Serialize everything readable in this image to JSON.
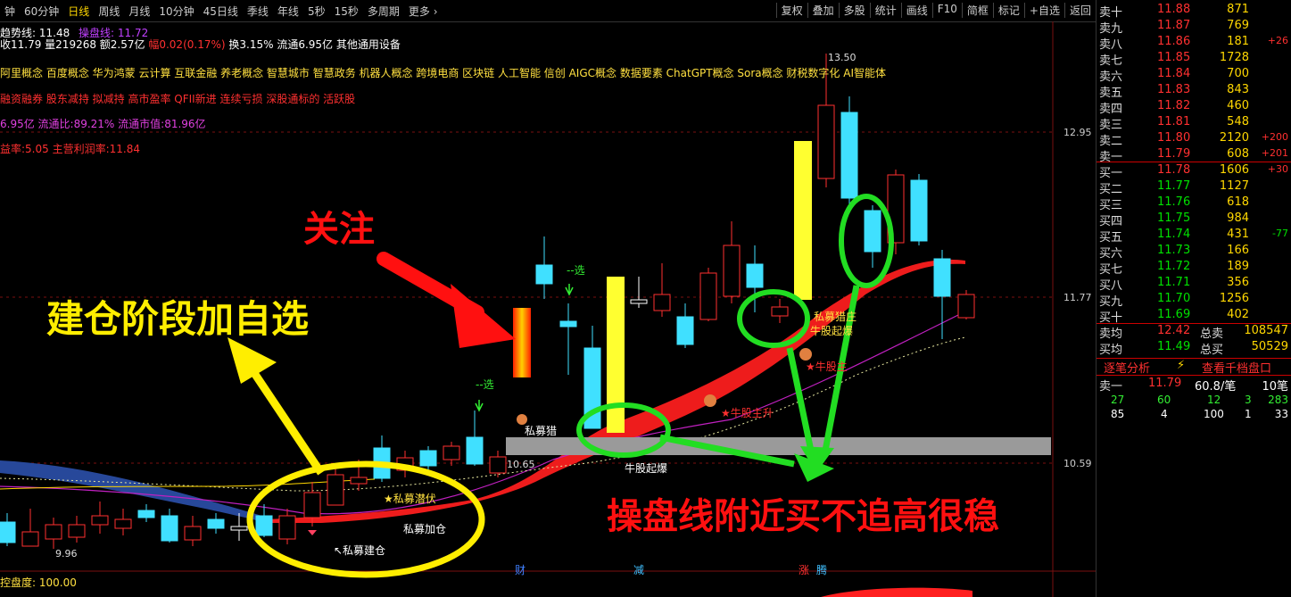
{
  "toolbar": {
    "periods": [
      "钟",
      "60分钟",
      "日线",
      "周线",
      "月线",
      "10分钟",
      "45日线",
      "季线",
      "年线",
      "5秒",
      "15秒",
      "多周期",
      "更多 ›"
    ],
    "tools": [
      "复权",
      "叠加",
      "多股",
      "统计",
      "画线",
      "F10",
      "简框",
      "标记",
      "+自选",
      "返回"
    ]
  },
  "chart_info": {
    "line1_a": "趋势线: 11.48",
    "line1_b": "操盘线: 11.72",
    "line2_a": "收11.79 量219268 额2.57亿",
    "line2_b": "幅0.02(0.17%)",
    "line2_c": "换3.15% 流通6.95亿 其他通用设备",
    "concepts": "阿里概念 百度概念 华为鸿蒙 云计算 互联金融 养老概念 智慧城市 智慧政务 机器人概念 跨境电商 区块链 人工智能 信创 AIGC概念 数据要素 ChatGPT概念 Sora概念 财税数字化 AI智能体",
    "tags": "融资融券 股东减持 拟减持 高市盈率 QFII新进 连续亏损 深股通标的 活跃股",
    "float": "6.95亿 流通比:89.21% 流通市值:81.96亿",
    "pe": "益率:5.05 主营利润率:11.84",
    "indicator": "控盘度: 100.00"
  },
  "axis": {
    "p1": "12.95",
    "p2": "11.77",
    "p3": "10.59",
    "high": "13.50",
    "low": "9.96",
    "mark": "10.65"
  },
  "markers": {
    "xuan1": "--选",
    "xuan2": "--选",
    "simu_zhu": "私募猎",
    "simu_qianfu": "★私募潜伏",
    "simu_jiacang": "私募加仓",
    "simu_jiancang": "↖私募建仓",
    "qibao": "牛股起爆",
    "niugu_zhusheng": "★牛股主升",
    "niugu_zhu": "★牛股主",
    "simu_zhuang": "私募猎庄",
    "niugu_qibao2": "牛股起爆",
    "cai": "财",
    "jian": "减",
    "zhang": "涨",
    "teng": "腾"
  },
  "annotations": {
    "left_text": "建仓阶段加自选",
    "top_text": "关注",
    "bottom_text": "操盘线附近买不追高很稳"
  },
  "orderbook": {
    "asks": [
      {
        "label": "卖十",
        "price": "11.88",
        "vol": "871",
        "chg": ""
      },
      {
        "label": "卖九",
        "price": "11.87",
        "vol": "769",
        "chg": ""
      },
      {
        "label": "卖八",
        "price": "11.86",
        "vol": "181",
        "chg": "+26"
      },
      {
        "label": "卖七",
        "price": "11.85",
        "vol": "1728",
        "chg": ""
      },
      {
        "label": "卖六",
        "price": "11.84",
        "vol": "700",
        "chg": ""
      },
      {
        "label": "卖五",
        "price": "11.83",
        "vol": "843",
        "chg": ""
      },
      {
        "label": "卖四",
        "price": "11.82",
        "vol": "460",
        "chg": ""
      },
      {
        "label": "卖三",
        "price": "11.81",
        "vol": "548",
        "chg": ""
      },
      {
        "label": "卖二",
        "price": "11.80",
        "vol": "2120",
        "chg": "+200"
      },
      {
        "label": "卖一",
        "price": "11.79",
        "vol": "608",
        "chg": "+201"
      }
    ],
    "bids": [
      {
        "label": "买一",
        "price": "11.78",
        "vol": "1606",
        "chg": "+30"
      },
      {
        "label": "买二",
        "price": "11.77",
        "vol": "1127",
        "chg": ""
      },
      {
        "label": "买三",
        "price": "11.76",
        "vol": "618",
        "chg": ""
      },
      {
        "label": "买四",
        "price": "11.75",
        "vol": "984",
        "chg": ""
      },
      {
        "label": "买五",
        "price": "11.74",
        "vol": "431",
        "chg": "-77"
      },
      {
        "label": "买六",
        "price": "11.73",
        "vol": "166",
        "chg": ""
      },
      {
        "label": "买七",
        "price": "11.72",
        "vol": "189",
        "chg": ""
      },
      {
        "label": "买八",
        "price": "11.71",
        "vol": "356",
        "chg": ""
      },
      {
        "label": "买九",
        "price": "11.70",
        "vol": "1256",
        "chg": ""
      },
      {
        "label": "买十",
        "price": "11.69",
        "vol": "402",
        "chg": ""
      }
    ],
    "avg_sell_label": "卖均",
    "avg_sell": "12.42",
    "total_sell_label": "总卖",
    "total_sell": "108547",
    "avg_buy_label": "买均",
    "avg_buy": "11.49",
    "total_buy_label": "总买",
    "total_buy": "50529",
    "tab_analysis": "逐笔分析",
    "tab_panel": "查看千档盘口",
    "sell1_label": "卖一",
    "sell1_price": "11.79",
    "sell1_avg": "60.8/笔",
    "sell1_count": "10笔",
    "row_a": [
      "27",
      "60",
      "12",
      "3",
      "283"
    ],
    "row_b": [
      "85",
      "4",
      "100",
      "1",
      "33"
    ]
  }
}
